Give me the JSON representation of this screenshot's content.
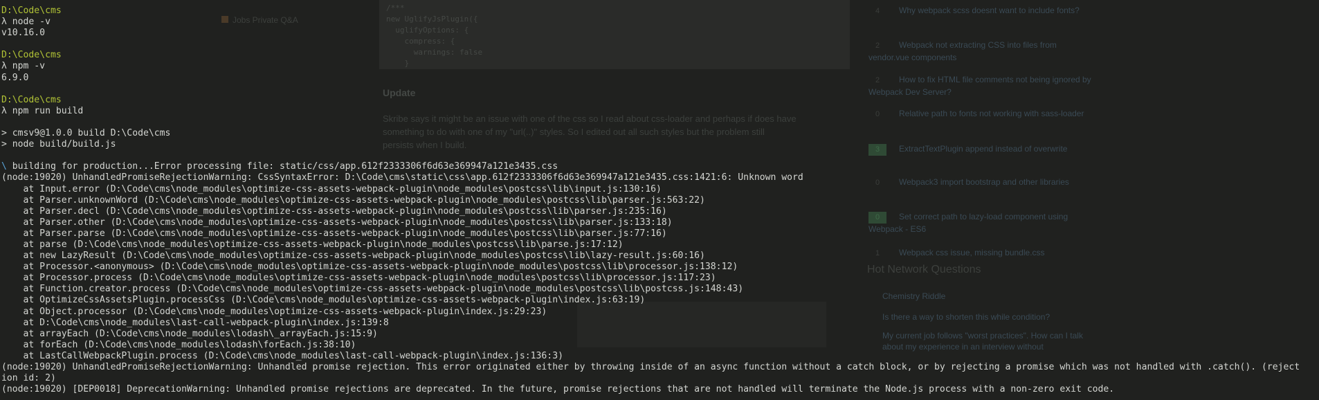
{
  "terminal": {
    "blocks": [
      {
        "path": "D:\\Code\\cms",
        "command": "λ node -v",
        "output": "v10.16.0"
      },
      {
        "path": "D:\\Code\\cms",
        "command": "λ npm -v",
        "output": "6.9.0"
      },
      {
        "path": "D:\\Code\\cms",
        "command": "λ npm run build"
      }
    ],
    "npm_lines": [
      "> cmsv9@1.0.0 build D:\\Code\\cms",
      "> node build/build.js"
    ],
    "spinner_glyph": "\\",
    "building_line": " building for production...Error processing file: static/css/app.612f2333306f6d63e369947a121e3435.css",
    "error_lines": [
      "(node:19020) UnhandledPromiseRejectionWarning: CssSyntaxError: D:\\Code\\cms\\static\\css\\app.612f2333306f6d63e369947a121e3435.css:1421:6: Unknown word",
      "    at Input.error (D:\\Code\\cms\\node_modules\\optimize-css-assets-webpack-plugin\\node_modules\\postcss\\lib\\input.js:130:16)",
      "    at Parser.unknownWord (D:\\Code\\cms\\node_modules\\optimize-css-assets-webpack-plugin\\node_modules\\postcss\\lib\\parser.js:563:22)",
      "    at Parser.decl (D:\\Code\\cms\\node_modules\\optimize-css-assets-webpack-plugin\\node_modules\\postcss\\lib\\parser.js:235:16)",
      "    at Parser.other (D:\\Code\\cms\\node_modules\\optimize-css-assets-webpack-plugin\\node_modules\\postcss\\lib\\parser.js:133:18)",
      "    at Parser.parse (D:\\Code\\cms\\node_modules\\optimize-css-assets-webpack-plugin\\node_modules\\postcss\\lib\\parser.js:77:16)",
      "    at parse (D:\\Code\\cms\\node_modules\\optimize-css-assets-webpack-plugin\\node_modules\\postcss\\lib\\parse.js:17:12)",
      "    at new LazyResult (D:\\Code\\cms\\node_modules\\optimize-css-assets-webpack-plugin\\node_modules\\postcss\\lib\\lazy-result.js:60:16)",
      "    at Processor.<anonymous> (D:\\Code\\cms\\node_modules\\optimize-css-assets-webpack-plugin\\node_modules\\postcss\\lib\\processor.js:138:12)",
      "    at Processor.process (D:\\Code\\cms\\node_modules\\optimize-css-assets-webpack-plugin\\node_modules\\postcss\\lib\\processor.js:117:23)",
      "    at Function.creator.process (D:\\Code\\cms\\node_modules\\optimize-css-assets-webpack-plugin\\node_modules\\postcss\\lib\\postcss.js:148:43)",
      "    at OptimizeCssAssetsPlugin.processCss (D:\\Code\\cms\\node_modules\\optimize-css-assets-webpack-plugin\\index.js:63:19)",
      "    at Object.processor (D:\\Code\\cms\\node_modules\\optimize-css-assets-webpack-plugin\\index.js:29:23)",
      "    at D:\\Code\\cms\\node_modules\\last-call-webpack-plugin\\index.js:139:8",
      "    at arrayEach (D:\\Code\\cms\\node_modules\\lodash\\_arrayEach.js:15:9)",
      "    at forEach (D:\\Code\\cms\\node_modules\\lodash\\forEach.js:38:10)",
      "    at LastCallWebpackPlugin.process (D:\\Code\\cms\\node_modules\\last-call-webpack-plugin\\index.js:136:3)",
      "(node:19020) UnhandledPromiseRejectionWarning: Unhandled promise rejection. This error originated either by throwing inside of an async function without a catch block, or by rejecting a promise which was not handled with .catch(). (reject",
      "ion id: 2)",
      "(node:19020) [DEP0018] DeprecationWarning: Unhandled promise rejections are deprecated. In the future, promise rejections that are not handled will terminate the Node.js process with a non-zero exit code."
    ]
  },
  "background_page": {
    "left_sidebar": [
      "Jobs Private Q&A"
    ],
    "code_lines": [
      "/***",
      "new UglifyJsPlugin({",
      "  uglifyOptions: {",
      "    compress: {",
      "      warnings: false",
      "    }"
    ],
    "update_heading": "Update",
    "paragraphs": [
      "Skribe says it might be an issue with one of the css so I read about css-loader and perhaps if does have",
      "something to do with one of my \"url(..)\" styles. So I edited out all such styles but the problem still",
      "persists when I build."
    ],
    "related": [
      {
        "votes": "4",
        "accepted": false,
        "title": "Why webpack scss doesnt want to include fonts?"
      },
      {
        "votes": "2",
        "accepted": false,
        "title": "Webpack not extracting CSS into files from vendor.vue components"
      },
      {
        "votes": "2",
        "accepted": false,
        "title": "How to fix HTML file comments not being ignored by Webpack Dev Server?"
      },
      {
        "votes": "0",
        "accepted": false,
        "title": "Relative path to fonts not working with sass-loader"
      },
      {
        "votes": "3",
        "accepted": true,
        "title": "ExtractTextPlugin append instead of overwrite"
      },
      {
        "votes": "0",
        "accepted": false,
        "title": "Webpack3 import bootstrap and other libraries"
      },
      {
        "votes": "0",
        "accepted": true,
        "title": "Set correct path to lazy-load component using Webpack - ES6"
      },
      {
        "votes": "1",
        "accepted": false,
        "title": "Webpack css issue, missing bundle.css"
      }
    ],
    "hot_network_heading": "Hot Network Questions",
    "hot_network": [
      "Chemistry Riddle",
      "Is there a way to shorten this while condition?",
      "My current job follows \"worst practices\". How can I talk about my experience in an interview without"
    ]
  }
}
